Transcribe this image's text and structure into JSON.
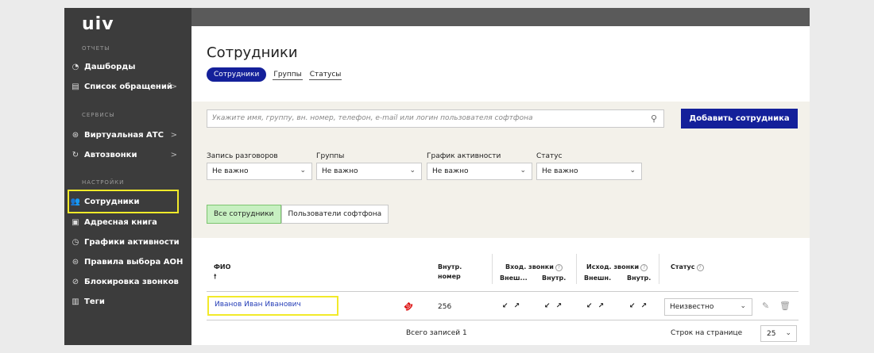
{
  "app": {
    "logo": "uiv"
  },
  "sidebar": {
    "sections": [
      {
        "header": "ОТЧЕТЫ",
        "items": [
          {
            "label": "Дашборды",
            "icon": "dashboard-icon",
            "chevron": ""
          },
          {
            "label": "Список обращений",
            "icon": "list-icon",
            "chevron": ">"
          }
        ]
      },
      {
        "header": "СЕРВИСЫ",
        "items": [
          {
            "label": "Виртуальная АТС",
            "icon": "pbx-icon",
            "chevron": ">"
          },
          {
            "label": "Автозвонки",
            "icon": "autocall-icon",
            "chevron": ">"
          }
        ]
      },
      {
        "header": "НАСТРОЙКИ",
        "items": [
          {
            "label": "Сотрудники",
            "icon": "employees-icon",
            "chevron": ""
          },
          {
            "label": "Адресная книга",
            "icon": "address-book-icon",
            "chevron": ""
          },
          {
            "label": "Графики активности",
            "icon": "clock-icon",
            "chevron": ""
          },
          {
            "label": "Правила выбора АОН",
            "icon": "caller-id-icon",
            "chevron": ""
          },
          {
            "label": "Блокировка звонков",
            "icon": "block-icon",
            "chevron": ""
          },
          {
            "label": "Теги",
            "icon": "tags-icon",
            "chevron": ""
          }
        ]
      }
    ]
  },
  "page": {
    "title": "Сотрудники",
    "tabs": [
      "Сотрудники",
      "Группы",
      "Статусы"
    ]
  },
  "search": {
    "placeholder": "Укажите имя, группу, вн. номер, телефон, e-mail или логин пользователя софтфона"
  },
  "add_button": "Добавить сотрудника",
  "filters": [
    {
      "label": "Запись разговоров",
      "value": "Не важно"
    },
    {
      "label": "Группы",
      "value": "Не важно"
    },
    {
      "label": "График активности",
      "value": "Не важно"
    },
    {
      "label": "Статус",
      "value": "Не важно"
    }
  ],
  "segments": [
    "Все сотрудники",
    "Пользователи софтфона"
  ],
  "table": {
    "headers": {
      "fio": "ФИО",
      "sort_arrow": "🠕",
      "ext_line1": "Внутр.",
      "ext_line2": "номер",
      "incoming": "Вход. звонки",
      "outgoing": "Исход. звонки",
      "status": "Статус",
      "in_ext": "Внеш...",
      "in_int": "Внутр.",
      "out_ext": "Внешн.",
      "out_int": "Внутр."
    },
    "rows": [
      {
        "name": "Иванов Иван Иванович",
        "ext": "256",
        "arrows": "↙ ↗",
        "status": "Неизвестно"
      }
    ],
    "total": "Всего записей 1",
    "per_page_label": "Строк на странице",
    "per_page": "25"
  },
  "colors": {
    "accent": "#14209a",
    "highlight": "#f2ea2a",
    "sidebar": "#3c3c3c"
  }
}
